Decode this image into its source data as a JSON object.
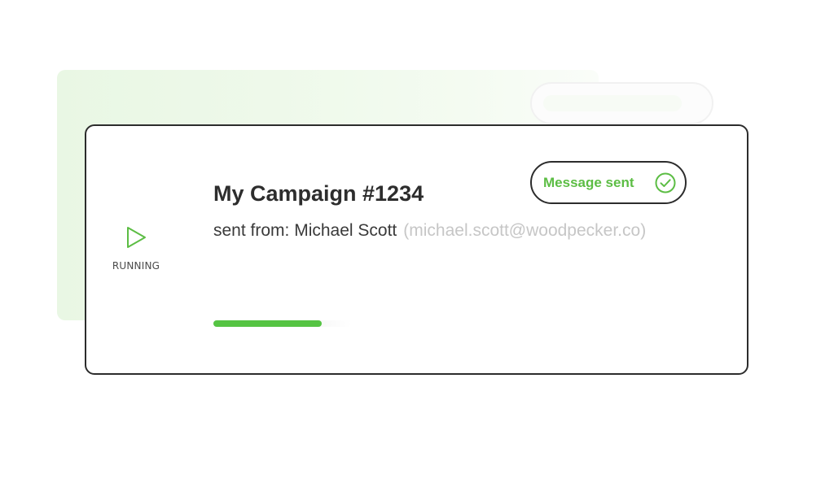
{
  "campaign": {
    "title": "My Campaign #1234",
    "sender_prefix": "sent from: Michael Scott",
    "sender_email": "(michael.scott@woodpecker.co)",
    "status_label": "RUNNING",
    "status_icon": "play-icon",
    "progress": 0.78
  },
  "notification": {
    "label": "Message sent",
    "icon": "check-circle-icon"
  },
  "colors": {
    "accent_green": "#55c443",
    "label_green": "#5cbd44",
    "border_dark": "#2c2c2c"
  }
}
